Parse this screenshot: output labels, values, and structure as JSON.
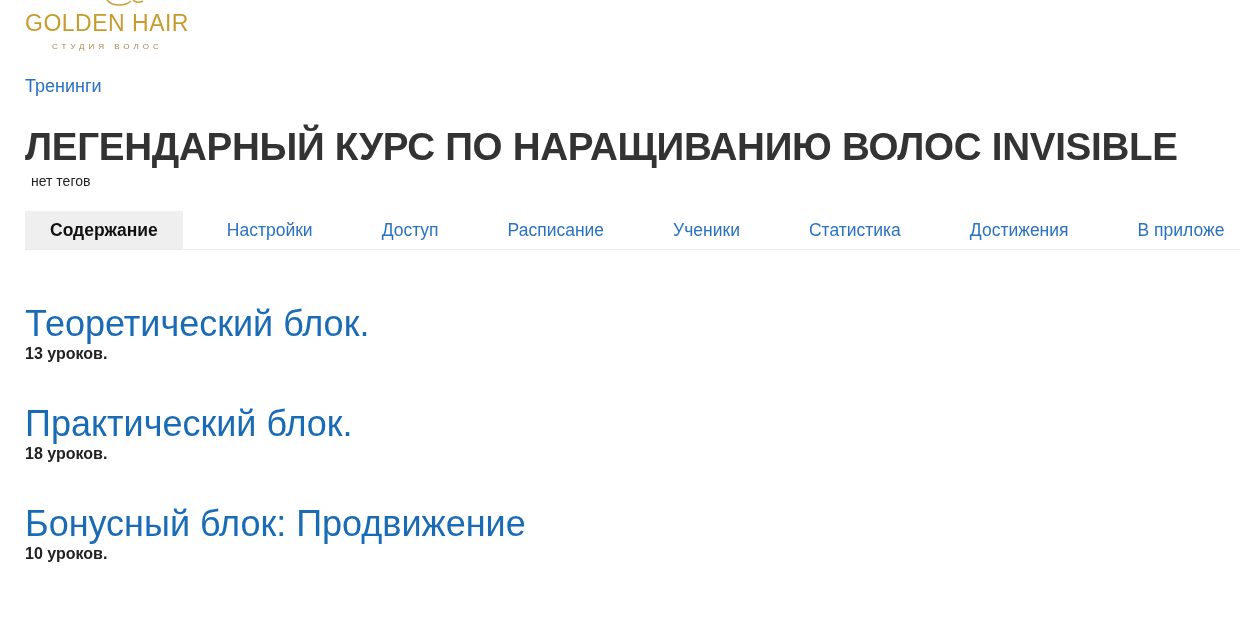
{
  "logo": {
    "name": "GOLDEN HAIR",
    "tagline": "СТУДИЯ ВОЛОС"
  },
  "breadcrumb": "Тренинги",
  "title": "ЛЕГЕНДАРНЫЙ КУРС ПО НАРАЩИВАНИЮ ВОЛОС INVISIBLE",
  "tags": "нет тегов",
  "tabs": [
    {
      "label": "Содержание",
      "selected": true
    },
    {
      "label": "Настройки",
      "selected": false
    },
    {
      "label": "Доступ",
      "selected": false
    },
    {
      "label": "Расписание",
      "selected": false
    },
    {
      "label": "Ученики",
      "selected": false
    },
    {
      "label": "Статистика",
      "selected": false
    },
    {
      "label": "Достижения",
      "selected": false
    },
    {
      "label": "В приложе",
      "selected": false
    }
  ],
  "sections": [
    {
      "title": "Теоретический блок.",
      "lessons": "13 уроков."
    },
    {
      "title": "Практический блок.",
      "lessons": "18 уроков."
    },
    {
      "title": "Бонусный блок: Продвижение",
      "lessons": "10 уроков."
    }
  ]
}
